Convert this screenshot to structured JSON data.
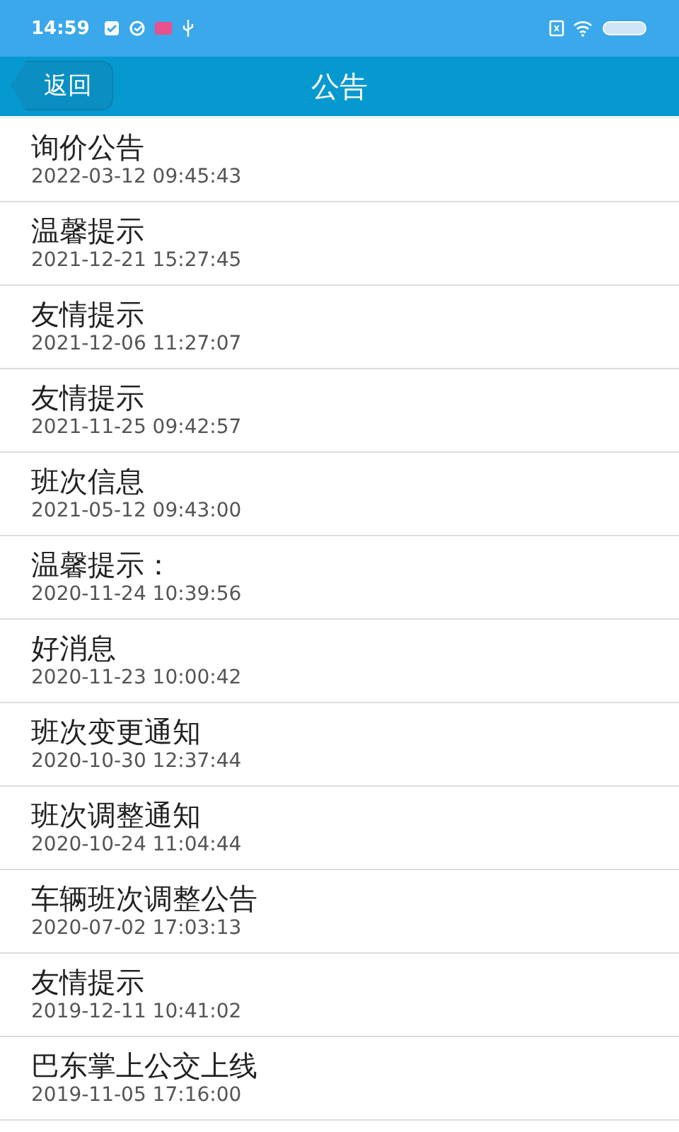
{
  "status_bar": {
    "time": "14:59"
  },
  "header": {
    "back_button": "返回",
    "title": "公告"
  },
  "notices": [
    {
      "title": "询价公告",
      "date": "2022-03-12 09:45:43"
    },
    {
      "title": "温馨提示",
      "date": "2021-12-21 15:27:45"
    },
    {
      "title": "友情提示",
      "date": "2021-12-06 11:27:07"
    },
    {
      "title": "友情提示",
      "date": "2021-11-25 09:42:57"
    },
    {
      "title": "班次信息",
      "date": "2021-05-12 09:43:00"
    },
    {
      "title": "温馨提示：",
      "date": "2020-11-24 10:39:56"
    },
    {
      "title": "好消息",
      "date": "2020-11-23 10:00:42"
    },
    {
      "title": "班次变更通知",
      "date": "2020-10-30 12:37:44"
    },
    {
      "title": "班次调整通知",
      "date": "2020-10-24 11:04:44"
    },
    {
      "title": "车辆班次调整公告",
      "date": "2020-07-02 17:03:13"
    },
    {
      "title": "友情提示",
      "date": "2019-12-11 10:41:02"
    },
    {
      "title": "巴东掌上公交上线",
      "date": "2019-11-05 17:16:00"
    }
  ]
}
